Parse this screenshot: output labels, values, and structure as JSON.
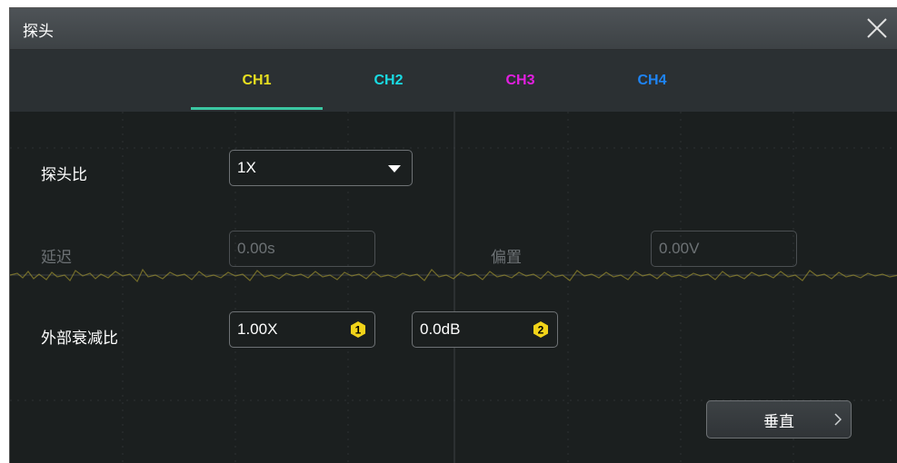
{
  "dialog": {
    "title": "探头",
    "close_icon": "close-icon"
  },
  "tabs": [
    {
      "label": "CH1",
      "color": "#e8e020",
      "active": true
    },
    {
      "label": "CH2",
      "color": "#19dbe3",
      "active": false
    },
    {
      "label": "CH3",
      "color": "#e21fe0",
      "active": false
    },
    {
      "label": "CH4",
      "color": "#1e84f5",
      "active": false
    }
  ],
  "probe_ratio": {
    "label": "探头比",
    "value": "1X"
  },
  "delay": {
    "label": "延迟",
    "value": "0.00s"
  },
  "offset": {
    "label": "偏置",
    "value": "0.00V"
  },
  "external_attenuation": {
    "label": "外部衰减比",
    "ratio_value": "1.00X",
    "ratio_badge": "1",
    "db_value": "0.0dB",
    "db_badge": "2"
  },
  "vertical_button": {
    "label": "垂直"
  },
  "colors": {
    "accent": "#3bc6a2",
    "badge": "#f1d319",
    "trace": "#b9a931"
  }
}
